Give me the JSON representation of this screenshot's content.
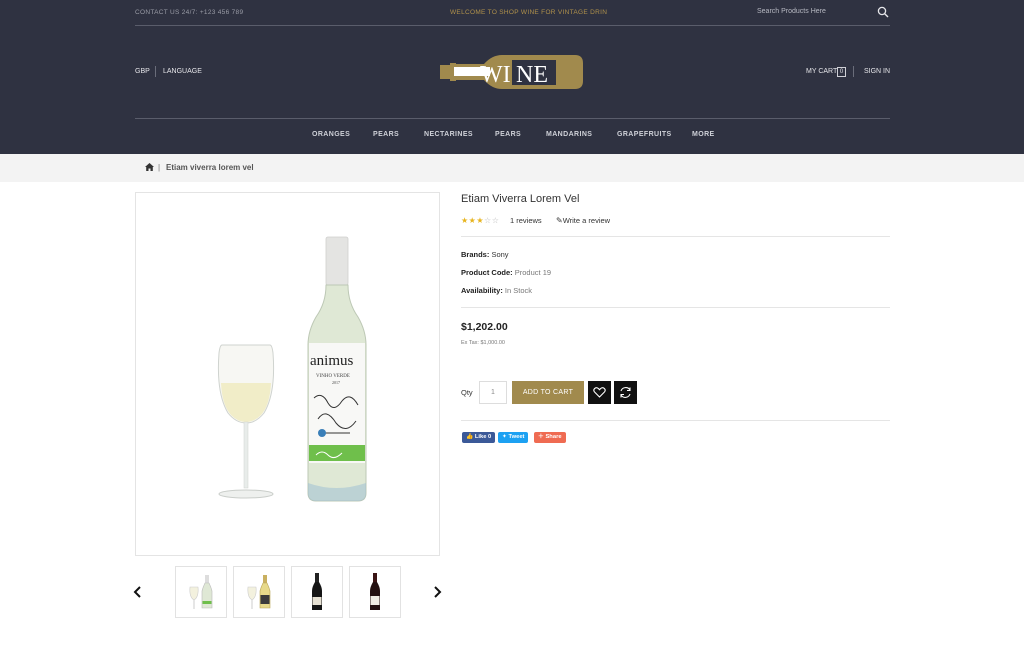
{
  "topbar": {
    "contact": "CONTACT US 24/7: +123 456 789",
    "welcome": "WELCOME TO SHOP WINE FOR VINTAGE DRIN",
    "search_placeholder": "Search Products Here"
  },
  "header": {
    "currency": "GBP",
    "language": "LANGUAGE",
    "logo_text": "WINE",
    "cart_label": "MY CART",
    "cart_count": "0",
    "sign_in": "SIGN IN"
  },
  "nav": {
    "items": [
      "ORANGES",
      "PEARS",
      "NECTARINES",
      "PEARS",
      "MANDARINS",
      "GRAPEFRUITS",
      "MORE"
    ]
  },
  "breadcrumb": {
    "separator": "|",
    "current": "Etiam viverra lorem vel"
  },
  "product": {
    "title": "Etiam Viverra Lorem Vel",
    "rating": 3,
    "rating_max": 5,
    "reviews": "1 reviews",
    "write_review": "Write a review",
    "brand_label": "Brands:",
    "brand_value": "Sony",
    "code_label": "Product Code:",
    "code_value": "Product 19",
    "availability_label": "Availability:",
    "availability_value": "In Stock",
    "price": "$1,202.00",
    "ex_tax": "Ex Tax: $1,000.00",
    "qty_label": "Qty",
    "qty_value": "1",
    "add_to_cart": "ADD TO CART",
    "share": {
      "like": "Like 0",
      "tweet": "Tweet",
      "share": "Share"
    }
  },
  "bottle_label": {
    "brand": "animus",
    "line1": "VINHO VERDE",
    "year": "2017"
  },
  "colors": {
    "header_bg": "#2f3241",
    "accent_gold": "#a18a4d",
    "facebook": "#3b5998",
    "twitter": "#1da1f2",
    "share": "#ef6b52"
  }
}
